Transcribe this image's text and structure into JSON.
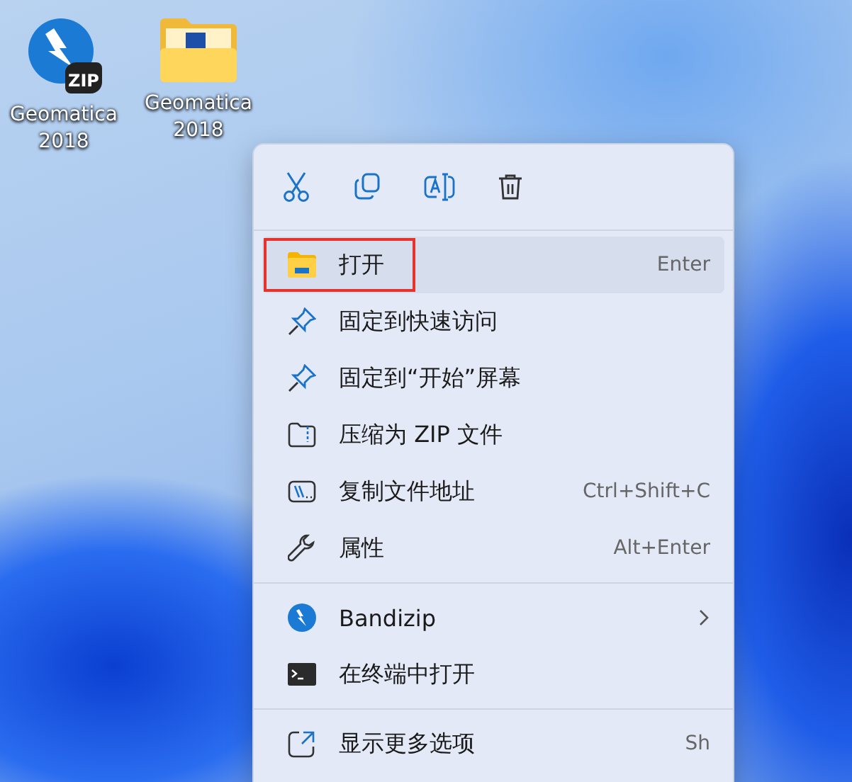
{
  "desktop_icons": [
    {
      "kind": "bandizip-archive",
      "badge": "ZIP",
      "label": "Geomatica\n2018"
    },
    {
      "kind": "folder",
      "label": "Geomatica\n2018"
    }
  ],
  "context_menu": {
    "toolbar": [
      {
        "kind": "cut"
      },
      {
        "kind": "copy"
      },
      {
        "kind": "rename"
      },
      {
        "kind": "delete"
      }
    ],
    "sections": [
      {
        "items": [
          {
            "kind": "folder",
            "label": "打开",
            "shortcut": "Enter",
            "submenu": false,
            "hovered": true,
            "marked": true
          },
          {
            "kind": "pin",
            "label": "固定到快速访问",
            "submenu": false,
            "hovered": false,
            "marked": false
          },
          {
            "kind": "pin",
            "label": "固定到“开始”屏幕",
            "submenu": false,
            "hovered": false,
            "marked": false
          },
          {
            "kind": "zip",
            "label": "压缩为 ZIP 文件",
            "submenu": false,
            "hovered": false,
            "marked": false
          },
          {
            "kind": "path",
            "label": "复制文件地址",
            "shortcut": "Ctrl+Shift+C",
            "submenu": false,
            "hovered": false,
            "marked": false
          },
          {
            "kind": "wrench",
            "label": "属性",
            "shortcut": "Alt+Enter",
            "submenu": false,
            "hovered": false,
            "marked": false
          }
        ]
      },
      {
        "items": [
          {
            "kind": "bandizip",
            "label": "Bandizip",
            "submenu": true,
            "hovered": false,
            "marked": false
          },
          {
            "kind": "terminal",
            "label": "在终端中打开",
            "submenu": false,
            "hovered": false,
            "marked": false
          }
        ]
      },
      {
        "items": [
          {
            "kind": "more",
            "label": "显示更多选项",
            "shortcut": "Sh",
            "submenu": false,
            "hovered": false,
            "marked": false
          }
        ]
      }
    ]
  }
}
